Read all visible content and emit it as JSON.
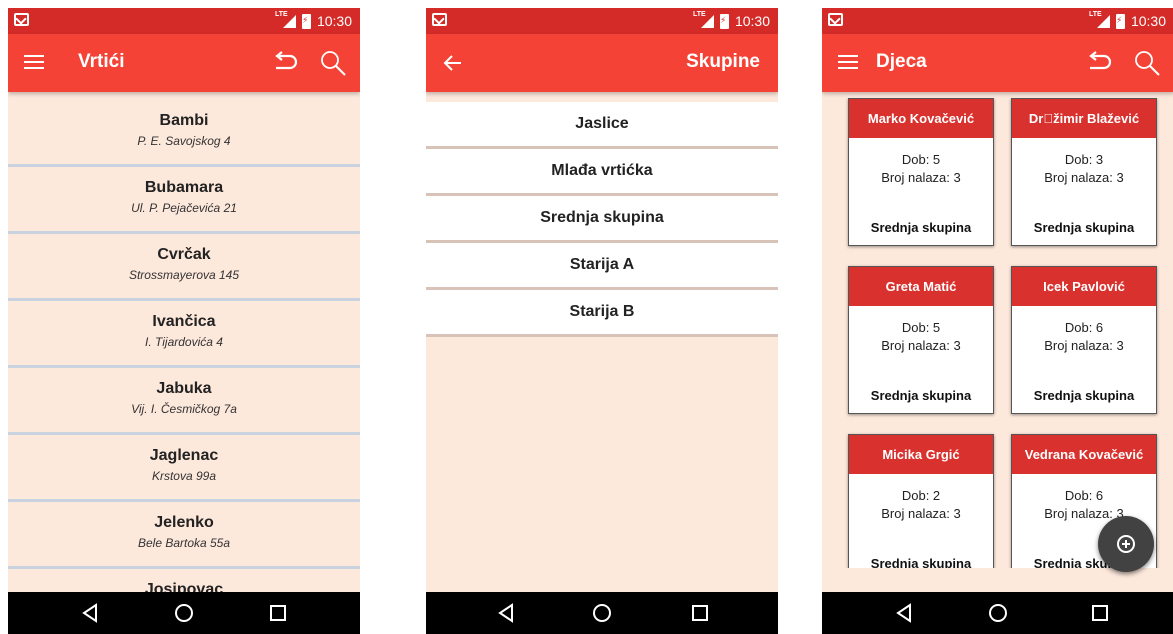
{
  "status_bar": {
    "time": "10:30",
    "network": "LTE"
  },
  "screen1": {
    "title": "Vrtići",
    "kindergartens": [
      {
        "name": "Bambi",
        "address": "P. E. Savojskog 4"
      },
      {
        "name": "Bubamara",
        "address": "Ul. P. Pejačevića 21"
      },
      {
        "name": "Cvrčak",
        "address": "Strossmayerova 145"
      },
      {
        "name": "Ivančica",
        "address": "I. Tijardovića 4"
      },
      {
        "name": "Jabuka",
        "address": "Vij. I. Česmičkog 7a"
      },
      {
        "name": "Jaglenac",
        "address": "Krstova 99a"
      },
      {
        "name": "Jelenko",
        "address": "Bele Bartoka 55a"
      },
      {
        "name": "Josipovac",
        "address": ""
      }
    ]
  },
  "screen2": {
    "title": "Skupine",
    "groups": [
      "Jaslice",
      "Mlađa vrtićka",
      "Srednja skupina",
      "Starija A",
      "Starija B"
    ]
  },
  "screen3": {
    "title": "Djeca",
    "children": [
      {
        "name": "Marko Kovačević",
        "age": "Dob: 5",
        "findings": "Broj nalaza: 3",
        "group": "Srednja skupina"
      },
      {
        "name": "Dr\u0000žimir Blažević",
        "age": "Dob: 3",
        "findings": "Broj nalaza: 3",
        "group": "Srednja skupina"
      },
      {
        "name": "Greta Matić",
        "age": "Dob: 5",
        "findings": "Broj nalaza: 3",
        "group": "Srednja skupina"
      },
      {
        "name": "Icek Pavlović",
        "age": "Dob: 6",
        "findings": "Broj nalaza: 3",
        "group": "Srednja skupina"
      },
      {
        "name": "Micika Grgić",
        "age": "Dob: 2",
        "findings": "Broj nalaza: 3",
        "group": "Srednja skupina"
      },
      {
        "name": "Vedrana Kovačević",
        "age": "Dob: 6",
        "findings": "Broj nalaza: 3",
        "group": "Srednja skupina"
      }
    ]
  },
  "icons": {
    "menu": "hamburger-menu-icon",
    "undo": "undo-icon",
    "search": "search-icon",
    "back": "arrow-back-icon",
    "add": "add-circle-icon",
    "nav_back": "nav-back-icon",
    "nav_home": "nav-home-icon",
    "nav_recents": "nav-recents-icon"
  },
  "colors": {
    "status_bar": "#d52b28",
    "toolbar": "#f44336",
    "background": "#fde8dc",
    "card_header": "#d9322e",
    "fab": "#424242"
  }
}
